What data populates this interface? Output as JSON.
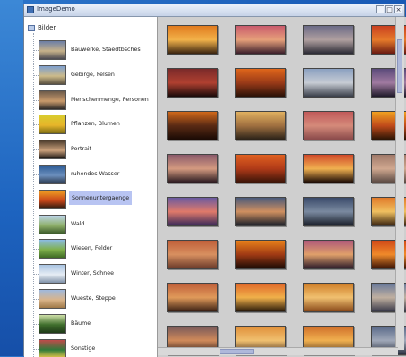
{
  "window": {
    "title": "ImageDemo",
    "buttons": {
      "minimize": "_",
      "maximize": "□",
      "close": "×"
    }
  },
  "tree": {
    "root_label": "Bilder",
    "items": [
      {
        "label": "Bauwerke, Staedtbsches",
        "colors": [
          "#6b7ea6",
          "#c7b28a",
          "#4b4a52"
        ]
      },
      {
        "label": "Gebirge, Felsen",
        "colors": [
          "#7ea0cf",
          "#cdbb8a",
          "#5b5141"
        ]
      },
      {
        "label": "Menschenmenge, Personen",
        "colors": [
          "#6d5b4b",
          "#c99a6b",
          "#2d2a28"
        ]
      },
      {
        "label": "Pflanzen, Blumen",
        "colors": [
          "#d9cc2e",
          "#e7b52a",
          "#7b6c13"
        ]
      },
      {
        "label": "Portrait",
        "colors": [
          "#4b3b2c",
          "#caa07b",
          "#1f1a16"
        ]
      },
      {
        "label": "ruhendes Wasser",
        "colors": [
          "#2b5a95",
          "#6c8fbd",
          "#2b3a4f"
        ]
      },
      {
        "label": "Sonnenuntergaenge",
        "colors": [
          "#f0a023",
          "#c9471a",
          "#2a1a10"
        ]
      },
      {
        "label": "Wald",
        "colors": [
          "#bcd4e8",
          "#8fb06a",
          "#3b5a2a"
        ]
      },
      {
        "label": "Wiesen, Felder",
        "colors": [
          "#8cbce4",
          "#7fb04b",
          "#3f6b24"
        ]
      },
      {
        "label": "Winter, Schnee",
        "colors": [
          "#a9c4e2",
          "#e7edf4",
          "#7f91a8"
        ]
      },
      {
        "label": "Wueste, Steppe",
        "colors": [
          "#9fb9dd",
          "#d9b48a",
          "#a07948"
        ]
      },
      {
        "label": "Bäume",
        "colors": [
          "#cfe0a8",
          "#3f6e2c",
          "#1f3a18"
        ]
      },
      {
        "label": "Sonstige",
        "colors": [
          "#c04b4b",
          "#2f7a3a",
          "#e6c74a"
        ]
      }
    ],
    "selected_index": 6
  },
  "gallery": {
    "photos": [
      [
        "#e07a1e",
        "#f2b24a",
        "#3a2410"
      ],
      [
        "#c95a6c",
        "#e6a07a",
        "#3b1f2c"
      ],
      [
        "#6a6a86",
        "#b0a0a0",
        "#2b2a35"
      ],
      [
        "#c94020",
        "#e67a2a",
        "#6a1a12"
      ],
      [
        "#7a2a2a",
        "#b04030",
        "#1a0a0a"
      ],
      [
        "#e0661a",
        "#9a3a18",
        "#2a1208"
      ],
      [
        "#8aa0c0",
        "#c7ccd4",
        "#3a3f4a"
      ],
      [
        "#5a4a7a",
        "#a07aa0",
        "#1f1a2a"
      ],
      [
        "#d0681a",
        "#5a2a14",
        "#1a0a05"
      ],
      [
        "#e0b060",
        "#a07040",
        "#2a2218"
      ],
      [
        "#c05a5a",
        "#d58a7a",
        "#8a4a4a"
      ],
      [
        "#f0a020",
        "#c04a1a",
        "#2a1405"
      ],
      [
        "#8a5a6a",
        "#d49a80",
        "#2a1a20"
      ],
      [
        "#e06020",
        "#b03a18",
        "#3a1408"
      ],
      [
        "#d04a2a",
        "#f0b050",
        "#1a0a05"
      ],
      [
        "#a07a6a",
        "#d0a890",
        "#5a4a44"
      ],
      [
        "#6a5aa0",
        "#e07a6a",
        "#3a2a5a"
      ],
      [
        "#4a5a7a",
        "#d09060",
        "#1a1f2a"
      ],
      [
        "#3a4a6a",
        "#7a8aa0",
        "#1a1f2a"
      ],
      [
        "#e07a2a",
        "#f0c060",
        "#3a2410"
      ],
      [
        "#c0603a",
        "#d89060",
        "#6a3a2a"
      ],
      [
        "#e8801a",
        "#a03a14",
        "#1a0a05"
      ],
      [
        "#b05a7a",
        "#e0a06a",
        "#2a1a2a"
      ],
      [
        "#d04a18",
        "#f08a2a",
        "#3a1205"
      ],
      [
        "#c0603a",
        "#e09a5a",
        "#3a2014"
      ],
      [
        "#e06a2a",
        "#f0b04a",
        "#2a1a0a"
      ],
      [
        "#d0802a",
        "#f0c070",
        "#8a4a1a"
      ],
      [
        "#6a7a9a",
        "#c0b0a0",
        "#3a3a4a"
      ],
      [
        "#7a5a5a",
        "#d08a5a",
        "#2a1a1a"
      ],
      [
        "#e0903a",
        "#f0c070",
        "#4a3020"
      ],
      [
        "#d0702a",
        "#f0b050",
        "#5a3a20"
      ],
      [
        "#5a6a8a",
        "#a0a8b8",
        "#2a3040"
      ]
    ]
  },
  "scrollbars": {
    "horizontal_position": 0.3,
    "vertical_position": 0.08
  }
}
